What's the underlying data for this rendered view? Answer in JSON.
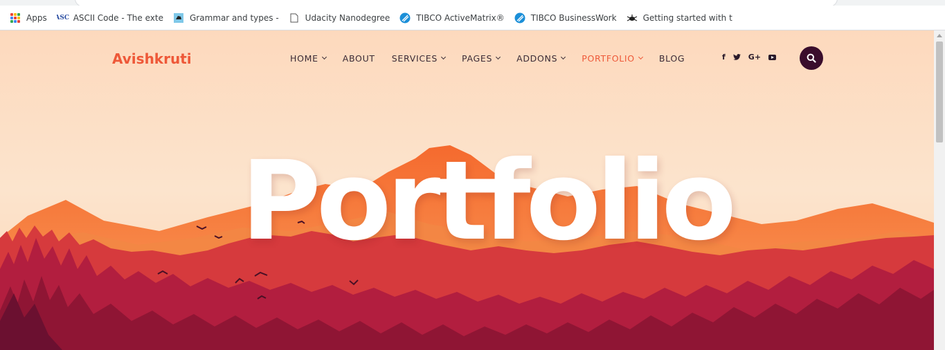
{
  "browser": {
    "bookmarks": [
      {
        "label": "Apps",
        "icon": "apps-grid-icon"
      },
      {
        "label": "ASCII Code - The exte",
        "icon": "ascii-favicon-icon"
      },
      {
        "label": "Grammar and types -",
        "icon": "grammar-favicon-icon"
      },
      {
        "label": "Udacity Nanodegree",
        "icon": "page-icon"
      },
      {
        "label": "TIBCO ActiveMatrix®",
        "icon": "tibco-favicon-icon"
      },
      {
        "label": "TIBCO BusinessWork",
        "icon": "tibco-favicon-icon"
      },
      {
        "label": "Getting started with t",
        "icon": "spider-favicon-icon"
      }
    ]
  },
  "site": {
    "logo": "Avishkruti",
    "nav": [
      {
        "label": "HOME",
        "dropdown": true,
        "active": false
      },
      {
        "label": "ABOUT",
        "dropdown": false,
        "active": false
      },
      {
        "label": "SERVICES",
        "dropdown": true,
        "active": false
      },
      {
        "label": "PAGES",
        "dropdown": true,
        "active": false
      },
      {
        "label": "ADDONS",
        "dropdown": true,
        "active": false
      },
      {
        "label": "PORTFOLIO",
        "dropdown": true,
        "active": true
      },
      {
        "label": "BLOG",
        "dropdown": false,
        "active": false
      }
    ],
    "social": {
      "facebook": "f",
      "twitter_icon": "twitter-icon",
      "googleplus": "G+",
      "youtube_icon": "youtube-icon"
    },
    "search_icon": "search-icon",
    "hero_title": "Portfolio"
  },
  "colors": {
    "accent": "#ee5838",
    "dark": "#3a0d2c",
    "sky_top": "#fde0c8",
    "mountain": "#f57a3a",
    "forest": "#a3173a"
  }
}
